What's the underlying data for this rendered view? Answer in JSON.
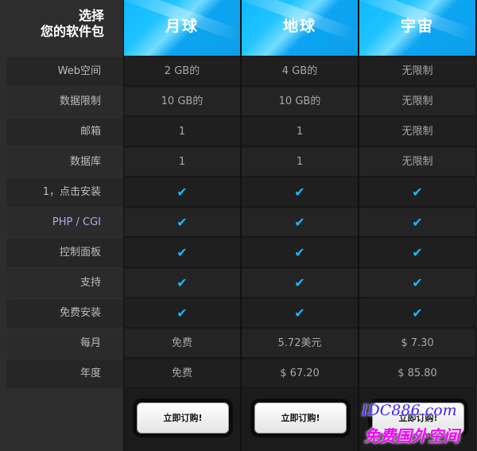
{
  "header": {
    "title_line1": "选择",
    "title_line2": "您的软件包"
  },
  "plans": [
    {
      "name": "月球",
      "cells": [
        "2 GB的",
        "10 GB的",
        "1",
        "1",
        "✔",
        "✔",
        "✔",
        "✔",
        "✔",
        "免费",
        "免费"
      ],
      "button": "立即订购!"
    },
    {
      "name": "地球",
      "cells": [
        "4 GB的",
        "10 GB的",
        "1",
        "1",
        "✔",
        "✔",
        "✔",
        "✔",
        "✔",
        "5.72美元",
        "$ 67.20"
      ],
      "button": "立即订购!"
    },
    {
      "name": "宇宙",
      "cells": [
        "无限制",
        "无限制",
        "无限制",
        "无限制",
        "✔",
        "✔",
        "✔",
        "✔",
        "✔",
        "$ 7.30",
        "$ 85.80"
      ],
      "button": "立即订购!"
    }
  ],
  "rows": [
    "Web空间",
    "数据限制",
    "邮箱",
    "数据库",
    "1，点击安装",
    "PHP / CGI",
    "控制面板",
    "支持",
    "免费安装",
    "每月",
    "年度"
  ],
  "watermark": {
    "line1": "IDC886.com",
    "line2": "免费国外空间"
  },
  "colors": {
    "accent": "#1db8ff",
    "header_gradient_start": "#10b8ff",
    "header_gradient_end": "#0d9ee9",
    "watermark_blue": "#3f23ff",
    "watermark_magenta": "#f200ff"
  }
}
